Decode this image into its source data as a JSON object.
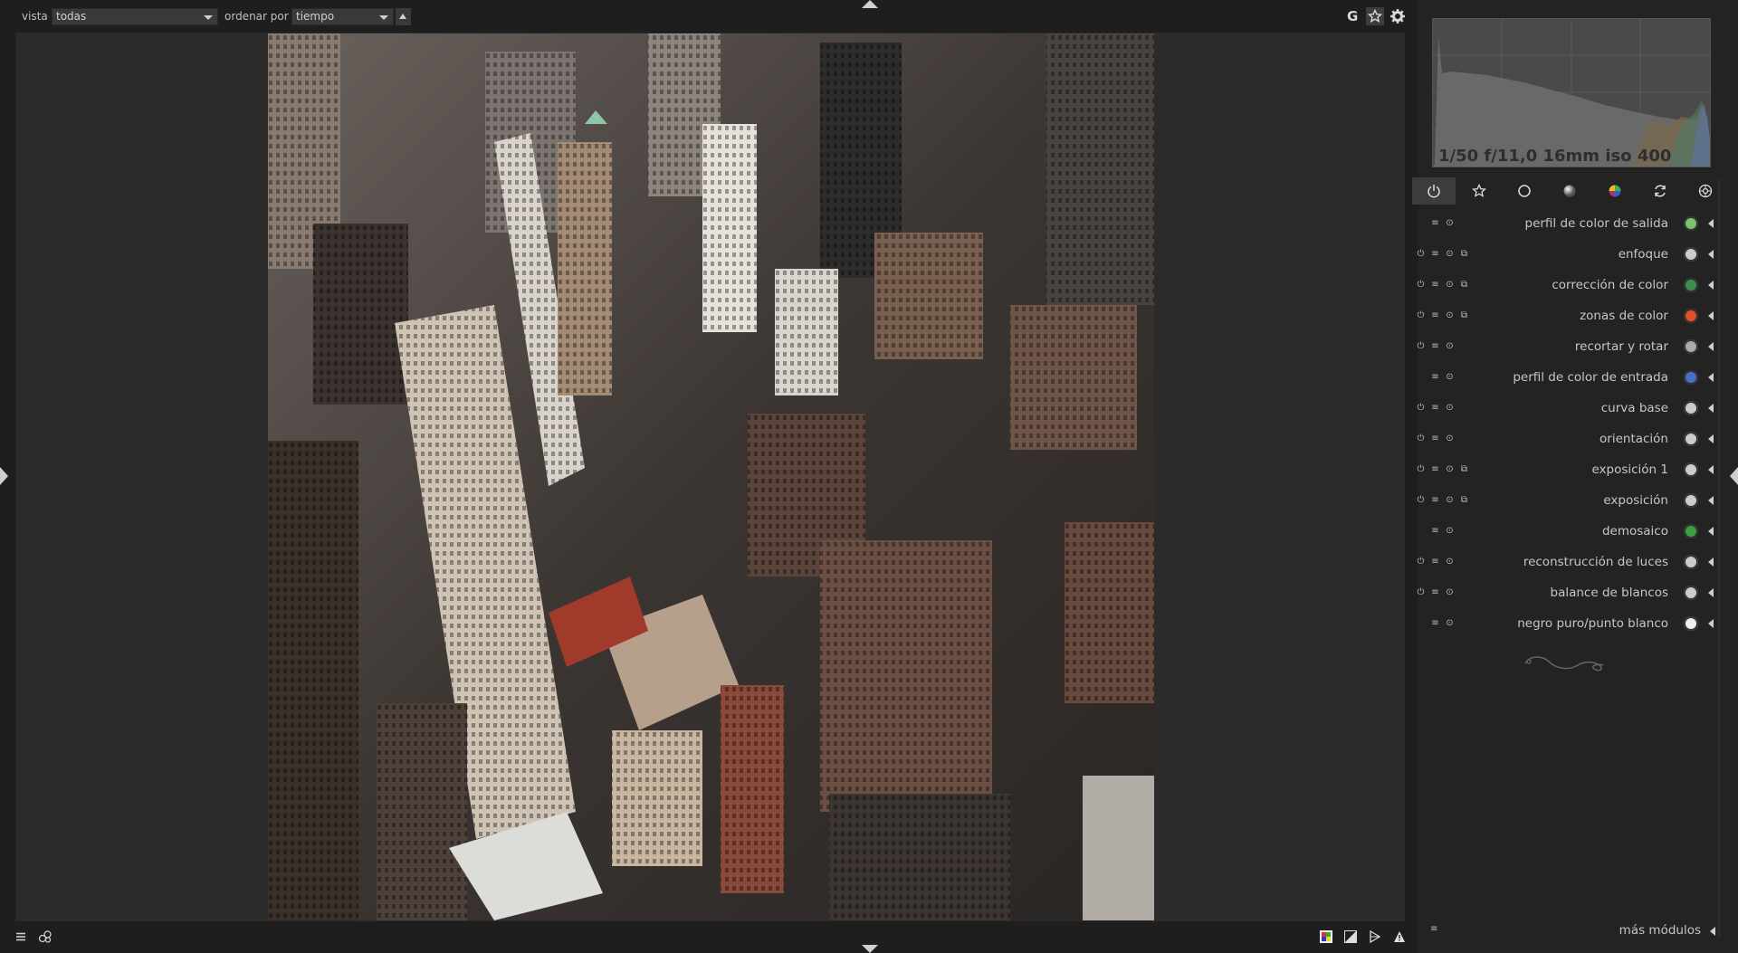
{
  "filter": {
    "view_label": "vista",
    "view_value": "todas",
    "sort_label": "ordenar por",
    "sort_value": "tiempo"
  },
  "top_icons": {
    "grouping": "G",
    "star": "star-icon",
    "settings": "gear-icon"
  },
  "histogram": {
    "exif": "1/50 f/11,0 16mm iso 400"
  },
  "module_groups": [
    {
      "name": "active-modules",
      "icon": "power-icon"
    },
    {
      "name": "favorites",
      "icon": "star-icon"
    },
    {
      "name": "basic",
      "icon": "circle-icon"
    },
    {
      "name": "tone",
      "icon": "tone-icon"
    },
    {
      "name": "color",
      "icon": "color-icon"
    },
    {
      "name": "correct",
      "icon": "correct-icon"
    },
    {
      "name": "effect",
      "icon": "effect-icon"
    }
  ],
  "modules": [
    {
      "label": "perfil de color de salida",
      "power": false,
      "preset": false
    },
    {
      "label": "enfoque",
      "power": true,
      "preset": true
    },
    {
      "label": "corrección de color",
      "power": true,
      "preset": true
    },
    {
      "label": "zonas de color",
      "power": true,
      "preset": true
    },
    {
      "label": "recortar y rotar",
      "power": true,
      "preset": false
    },
    {
      "label": "perfil de color de entrada",
      "power": false,
      "preset": false
    },
    {
      "label": "curva base",
      "power": true,
      "preset": false
    },
    {
      "label": "orientación",
      "power": true,
      "preset": false
    },
    {
      "label": "exposición 1",
      "power": true,
      "preset": true
    },
    {
      "label": "exposición",
      "power": true,
      "preset": true
    },
    {
      "label": "demosaico",
      "power": false,
      "preset": false
    },
    {
      "label": "reconstrucción de luces",
      "power": true,
      "preset": false
    },
    {
      "label": "balance de blancos",
      "power": true,
      "preset": false
    },
    {
      "label": "negro puro/punto blanco",
      "power": false,
      "preset": false
    }
  ],
  "more_modules": "más módulos",
  "colors": {
    "background": "#1e1e1e",
    "center": "#2b2b2b",
    "panel": "#232323",
    "text": "#c6c6c6"
  }
}
